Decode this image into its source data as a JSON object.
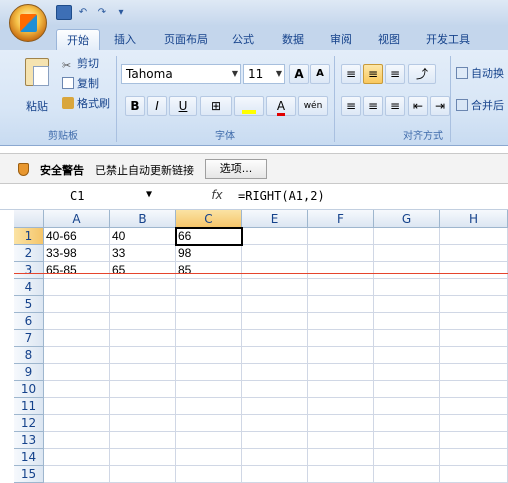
{
  "quick_access": {
    "icons": [
      "save-icon",
      "undo-icon",
      "redo-icon",
      "customize-icon"
    ]
  },
  "tabs": [
    "开始",
    "插入",
    "页面布局",
    "公式",
    "数据",
    "审阅",
    "视图",
    "开发工具"
  ],
  "ribbon": {
    "clipboard": {
      "paste": "粘贴",
      "cut": "剪切",
      "copy": "复制",
      "format_painter": "格式刷",
      "label": "剪贴板"
    },
    "font": {
      "name": "Tahoma",
      "size": "11",
      "grow": "A",
      "shrink": "A",
      "bold": "B",
      "italic": "I",
      "underline": "U",
      "phonetic": "wén",
      "label": "字体"
    },
    "alignment": {
      "wrap": "自动换",
      "merge": "合并后",
      "label": "对齐方式"
    }
  },
  "security": {
    "title": "安全警告",
    "message": "已禁止自动更新链接",
    "options_button": "选项..."
  },
  "formula_bar": {
    "name_box": "C1",
    "fx": "fx",
    "formula": "=RIGHT(A1,2)"
  },
  "sheet": {
    "columns": [
      "A",
      "B",
      "C",
      "E",
      "F",
      "G",
      "H"
    ],
    "rows": [
      "1",
      "2",
      "3",
      "4",
      "5",
      "6",
      "7",
      "8",
      "9",
      "10",
      "11",
      "12",
      "13",
      "14",
      "15"
    ],
    "data": [
      [
        "40-66",
        "40",
        "66"
      ],
      [
        "33-98",
        "33",
        "98"
      ],
      [
        "65-85",
        "65",
        "85"
      ]
    ],
    "selected_cell": "C1"
  },
  "colors": {
    "accent": "#15428b",
    "selection": "#f5c56a",
    "annotation_line": "#e5442d"
  }
}
